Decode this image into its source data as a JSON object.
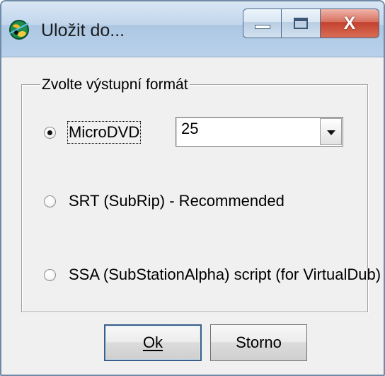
{
  "window": {
    "title": "Uložit do...",
    "icon": "app-green-globe-icon",
    "controls": {
      "minimize": "minimize-icon",
      "maximize": "maximize-icon",
      "close_label": "X"
    }
  },
  "dialog": {
    "group_title": "Zvolte výstupní formát",
    "formats": [
      {
        "label": "MicroDVD",
        "selected": true
      },
      {
        "label": "SRT (SubRip) - Recommended",
        "selected": false
      },
      {
        "label": "SSA (SubStationAlpha) script (for VirtualDub)",
        "selected": false
      }
    ],
    "framerate_select": {
      "value": "25",
      "icon": "chevron-down-icon"
    },
    "buttons": {
      "ok_label": "Ok",
      "cancel_label": "Storno"
    }
  },
  "colors": {
    "window_frame": "#6f8aa6",
    "titlebar": "#c2d6ec",
    "close_button": "#c4412f",
    "dialog_background": "#f0f0f0"
  }
}
